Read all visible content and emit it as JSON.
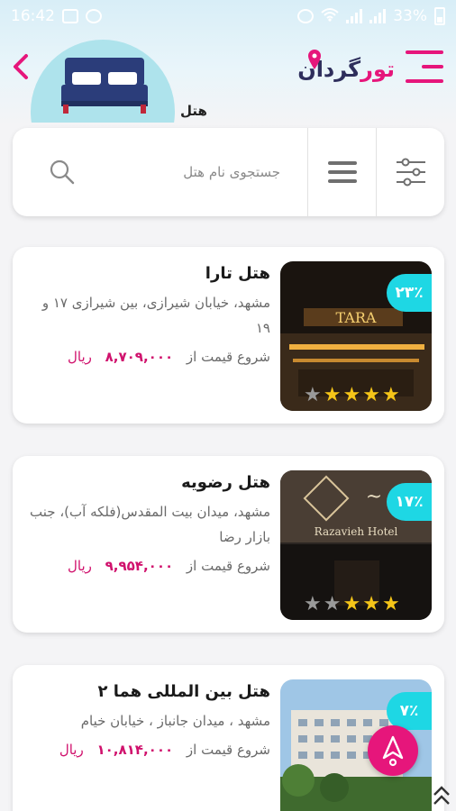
{
  "status_bar": {
    "time": "16:42",
    "battery": "33%"
  },
  "header": {
    "category_label": "هتل",
    "brand": {
      "part_a": "تور",
      "part_b": "گردان"
    }
  },
  "search": {
    "placeholder": "جستجوی نام هتل"
  },
  "hotels": [
    {
      "name": "هتل تارا",
      "address": "مشهد، خیابان شیرازی، بین شیرازی ۱۷ و ۱۹",
      "price_prefix": "شروع قیمت از",
      "price": "۸,۷۰۹,۰۰۰",
      "currency": "ریال",
      "discount": "۲۳٪",
      "stars": 4,
      "star_slots": 5
    },
    {
      "name": "هتل رضویه",
      "address": "مشهد، میدان بیت المقدس(فلکه آب)، جنب بازار رضا",
      "price_prefix": "شروع قیمت از",
      "price": "۹,۹۵۴,۰۰۰",
      "currency": "ریال",
      "discount": "۱۷٪",
      "stars": 3,
      "star_slots": 5
    },
    {
      "name": "هتل بین المللی هما ۲",
      "address": "مشهد ، میدان جانباز ، خیابان خیام",
      "price_prefix": "شروع قیمت از",
      "price": "۱۰,۸۱۴,۰۰۰",
      "currency": "ریال",
      "discount": "۷٪",
      "stars": 0,
      "star_slots": 0
    }
  ],
  "colors": {
    "brand_pink": "#e6167b",
    "price_pink": "#d0126d",
    "discount_cyan": "#1ed7e4",
    "star_gold": "#f5c518"
  },
  "photo_signs": {
    "hotel_1": "TARA",
    "hotel_2": "Razavieh Hotel"
  }
}
